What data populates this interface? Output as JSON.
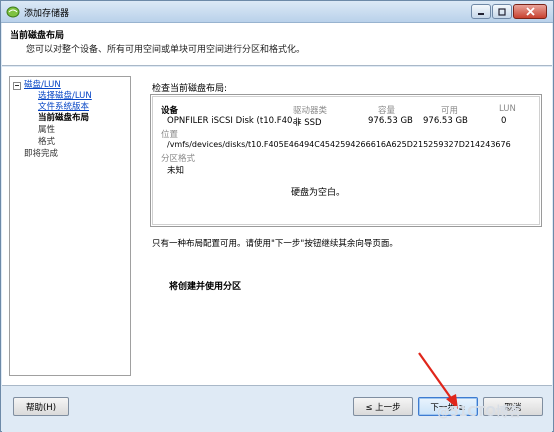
{
  "window": {
    "title": "添加存储器"
  },
  "header": {
    "title": "当前磁盘布局",
    "subtitle": "您可以对整个设备、所有可用空间或单块可用空间进行分区和格式化。"
  },
  "nav": {
    "items": [
      {
        "label": "磁盘/LUN",
        "kind": "link"
      },
      {
        "label": "选择磁盘/LUN",
        "kind": "link"
      },
      {
        "label": "文件系统版本",
        "kind": "link"
      },
      {
        "label": "当前磁盘布局",
        "kind": "current"
      },
      {
        "label": "属性",
        "kind": "plain"
      },
      {
        "label": "格式",
        "kind": "plain"
      },
      {
        "label": "即将完成",
        "kind": "plain"
      }
    ]
  },
  "main": {
    "section_label": "检查当前磁盘布局:",
    "columns": {
      "device": "设备",
      "drive_type": "驱动器类",
      "capacity": "容量",
      "available": "可用",
      "lun": "LUN"
    },
    "row": {
      "device": "OPNFILER iSCSI Disk (t10.F40...",
      "drive_type": "非 SSD",
      "capacity": "976.53 GB",
      "available": "976.53 GB",
      "lun": "0"
    },
    "location_label": "位置",
    "location_value": "/vmfs/devices/disks/t10.F405E46494C4542594266616A625D215259327D214243676",
    "partition_label": "分区格式",
    "partition_value": "未知",
    "empty_message": "硬盘为空白。",
    "only_one_message": "只有一种布局配置可用。请使用\"下一步\"按钮继续其余向导页面。",
    "will_create_message": "将创建并使用分区"
  },
  "footer": {
    "help": "帮助(H)",
    "back": "≤ 上一步",
    "next": "下一步 ≥",
    "cancel": "取消"
  },
  "watermark": "@51CTO博客",
  "colors": {
    "link": "#0645c5",
    "arrow": "#e0261b",
    "title_bar": "#b9d1ea"
  }
}
